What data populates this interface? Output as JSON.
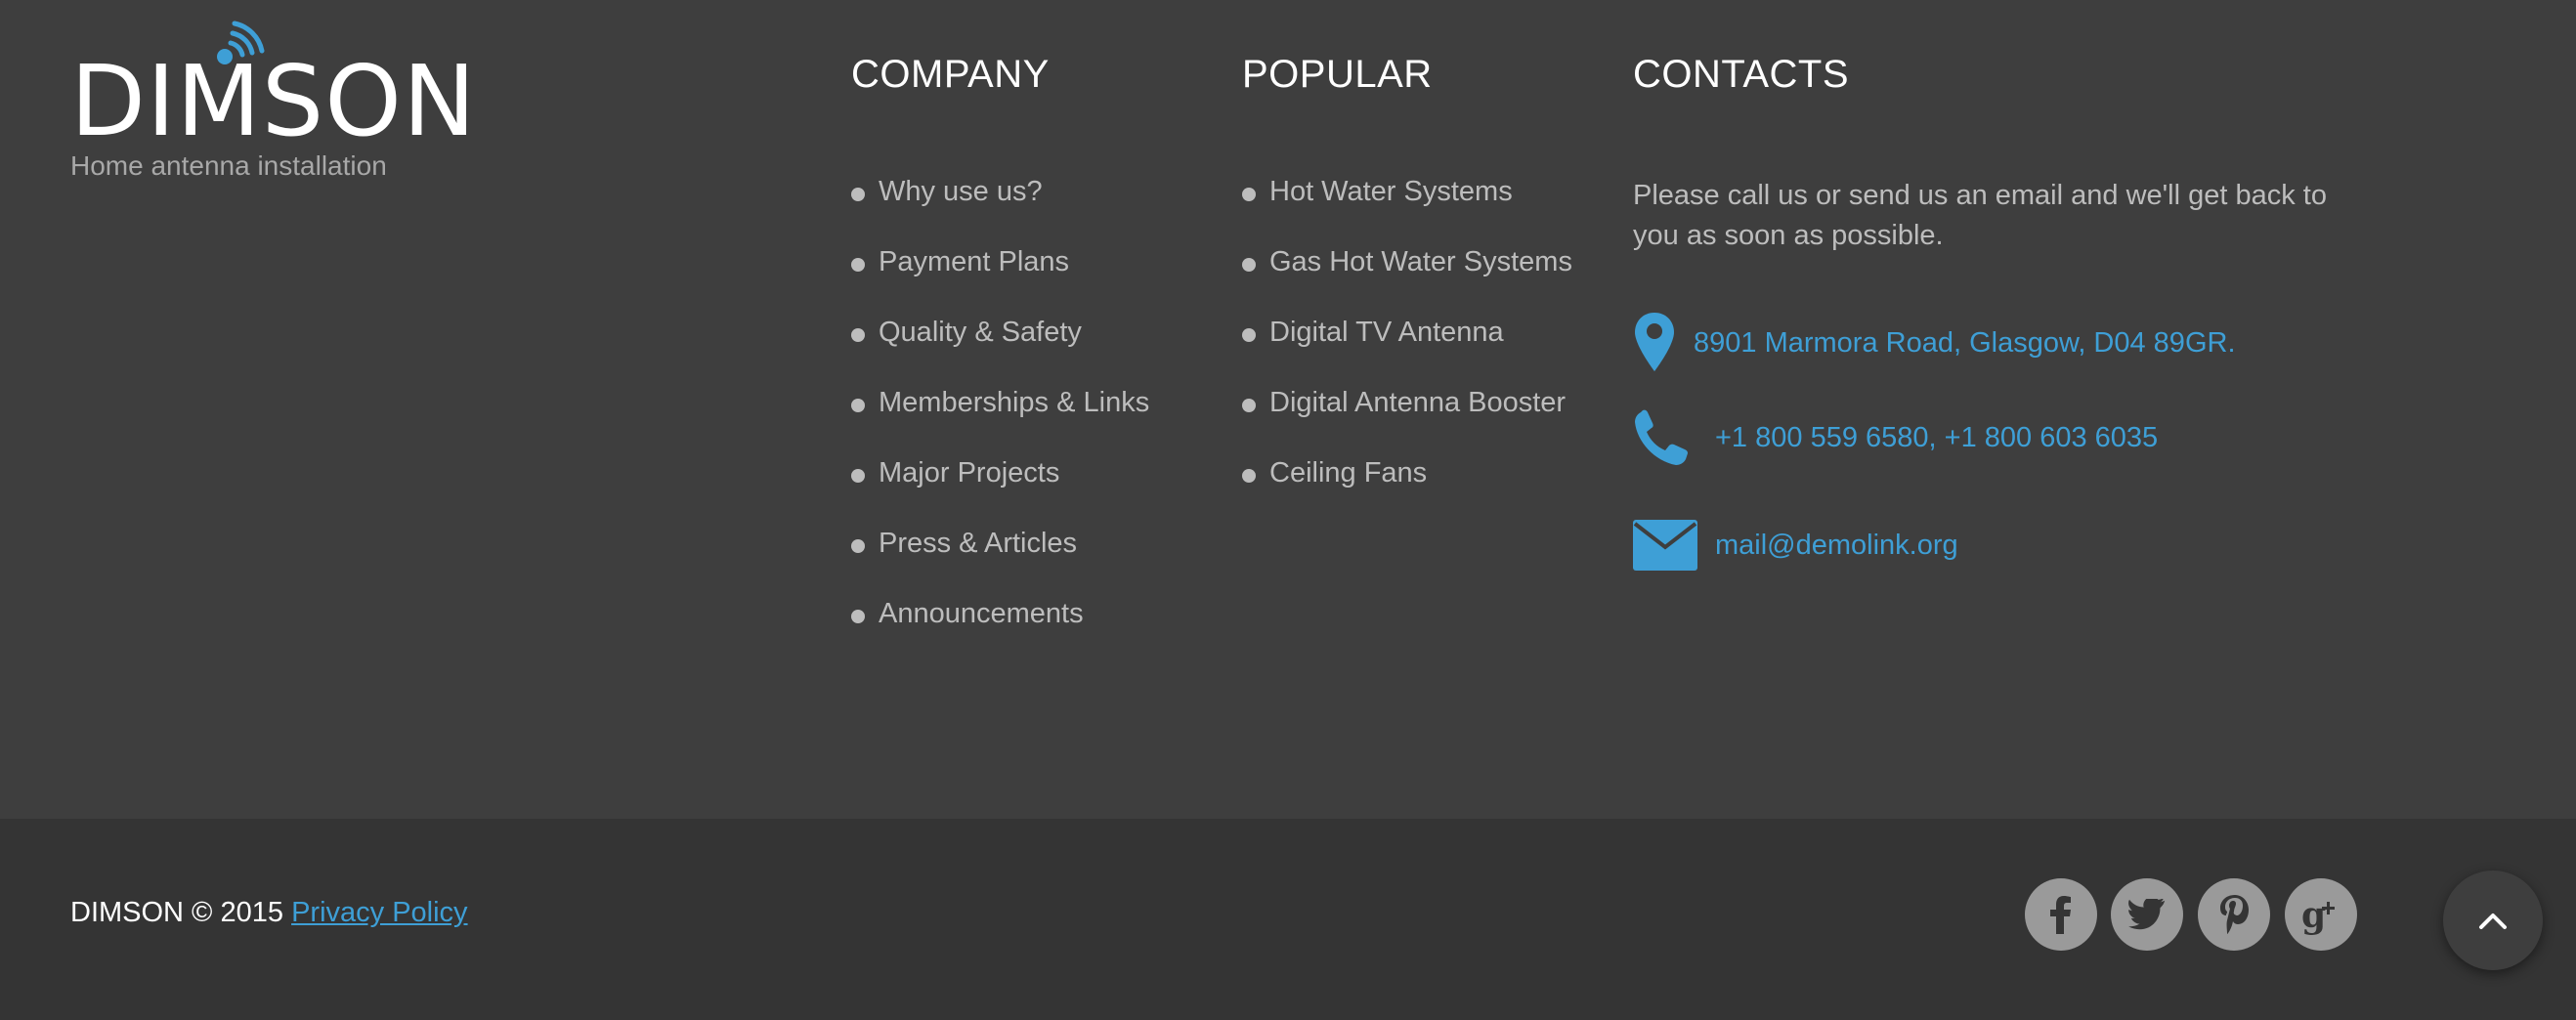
{
  "brand": {
    "name": "DIMSON",
    "tagline": "Home antenna installation",
    "accent_color": "#3e9fd6"
  },
  "company": {
    "heading": "COMPANY",
    "items": [
      "Why use us?",
      "Payment Plans",
      "Quality & Safety",
      "Memberships & Links",
      "Major Projects",
      "Press & Articles",
      "Announcements"
    ]
  },
  "popular": {
    "heading": "POPULAR",
    "items": [
      "Hot Water Systems",
      "Gas Hot Water Systems",
      "Digital TV Antenna",
      "Digital Antenna Booster",
      "Ceiling Fans"
    ]
  },
  "contacts": {
    "heading": "CONTACTS",
    "intro": "Please call us or send us an email and we'll get back to you as soon as possible.",
    "address": "8901 Marmora Road, Glasgow, D04 89GR.",
    "phone": "+1 800 559 6580, +1 800 603 6035",
    "email": "mail@demolink.org",
    "icons": [
      "map-pin-icon",
      "phone-icon",
      "envelope-icon"
    ]
  },
  "footer": {
    "copyright": "DIMSON © 2015",
    "privacy_label": "Privacy Policy",
    "social_icons": [
      "facebook-icon",
      "twitter-icon",
      "pinterest-icon",
      "google-plus-icon"
    ],
    "to_top_icon": "chevron-up-icon"
  }
}
